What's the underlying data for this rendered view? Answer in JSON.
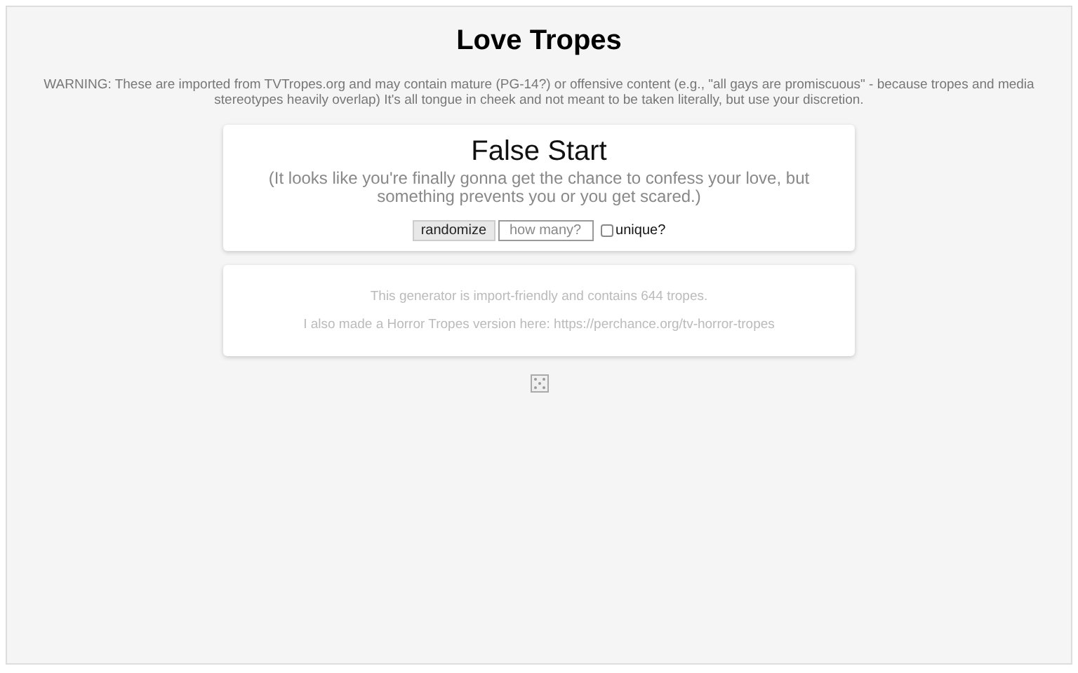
{
  "title": "Love Tropes",
  "warning": "WARNING: These are imported from TVTropes.org and may contain mature (PG-14?) or offensive content (e.g., \"all gays are promiscuous\" - because tropes and media stereotypes heavily overlap) It's all tongue in cheek and not meant to be taken literally, but use your discretion.",
  "result": {
    "name": "False Start",
    "description": "(It looks like you're finally gonna get the chance to confess your love, but something prevents you or you get scared.)"
  },
  "controls": {
    "button": "randomize",
    "count_field": {
      "placeholder": "how many?"
    },
    "unique": {
      "label": "unique?",
      "checked": false
    }
  },
  "info": [
    "This generator is import-friendly and contains 644 tropes.",
    "I also made a Horror Tropes version here: https://perchance.org/tv-horror-tropes"
  ]
}
